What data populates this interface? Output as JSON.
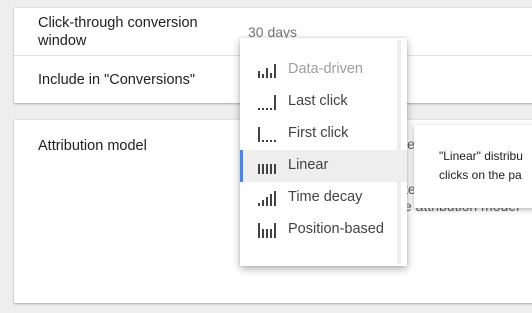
{
  "settings": {
    "click_through_label_line1": "Click-through conversion",
    "click_through_label_line2": "window",
    "click_through_value": "30 days",
    "include_label": "Include in \"Conversions\"",
    "attribution_label": "Attribution model",
    "bg_fragment_1": "le",
    "bg_fragment_2": "te",
    "bg_fragment_3": "e attribution model"
  },
  "attribution_menu": {
    "selected_index": 3,
    "accent_color": "#4285f4",
    "items": [
      {
        "label": "Data-driven",
        "icon": "data-driven-icon",
        "disabled": true
      },
      {
        "label": "Last click",
        "icon": "last-click-icon",
        "disabled": false
      },
      {
        "label": "First click",
        "icon": "first-click-icon",
        "disabled": false
      },
      {
        "label": "Linear",
        "icon": "linear-icon",
        "disabled": false
      },
      {
        "label": "Time decay",
        "icon": "time-decay-icon",
        "disabled": false
      },
      {
        "label": "Position-based",
        "icon": "position-based-icon",
        "disabled": false
      }
    ]
  },
  "tooltip": {
    "line1": "\"Linear\" distribu",
    "line2": "clicks on the pa"
  }
}
